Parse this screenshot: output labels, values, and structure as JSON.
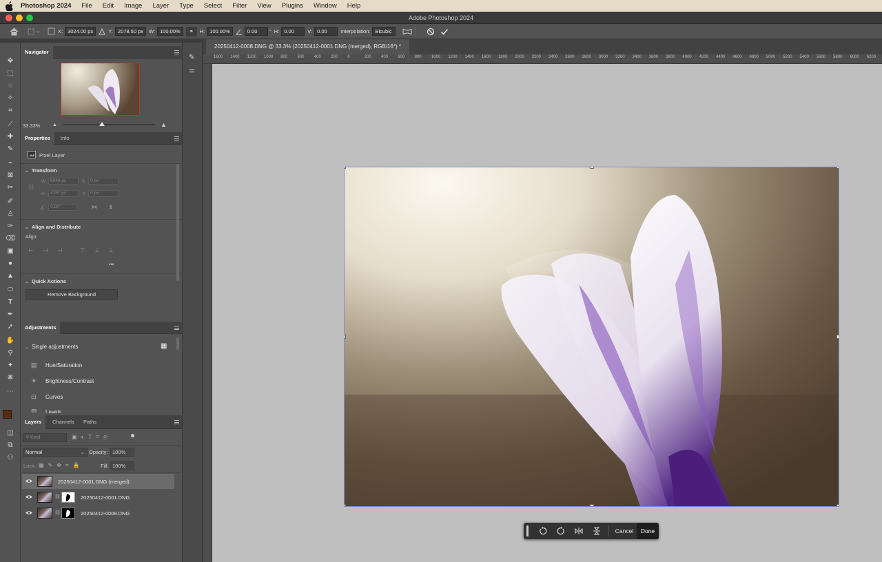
{
  "menubar": {
    "app": "Photoshop 2024",
    "items": [
      "File",
      "Edit",
      "Image",
      "Layer",
      "Type",
      "Select",
      "Filter",
      "View",
      "Plugins",
      "Window",
      "Help"
    ]
  },
  "window": {
    "title": "Adobe Photoshop 2024"
  },
  "options": {
    "x_label": "X:",
    "x_value": "3024.00 px",
    "y_label": "Y:",
    "y_value": "2078.50 px",
    "w_label": "W:",
    "w_value": "100.00%",
    "h_label": "H:",
    "h_value": "100.00%",
    "angle_value": "0.00",
    "angle_unit": "°",
    "hskew_label": "H:",
    "hskew_value": "0.00",
    "vskew_label": "V:",
    "vskew_value": "0.00",
    "interp_label": "Interpolation:",
    "interp_value": "Bicubic"
  },
  "document": {
    "tab_title": "20250412-0008.DNG @ 33.3% (20250412-0001.DNG (merged), RGB/16*) *"
  },
  "ruler": {
    "h_labels": [
      "1600",
      "1400",
      "1200",
      "1000",
      "800",
      "600",
      "400",
      "200",
      "0",
      "200",
      "400",
      "600",
      "800",
      "1000",
      "1200",
      "1400",
      "1600",
      "1800",
      "2000",
      "2200",
      "2400",
      "2600",
      "2800",
      "3000",
      "3200",
      "3400",
      "3600",
      "3800",
      "4000",
      "4200",
      "4400",
      "4600",
      "4800",
      "5000",
      "5200",
      "5400",
      "5600",
      "5800",
      "6000",
      "6200",
      "6400"
    ]
  },
  "navigator": {
    "tab": "Navigator",
    "zoom": "33.33%",
    "slider_fraction": 0.42
  },
  "properties": {
    "tabs": [
      "Properties",
      "Info"
    ],
    "layer_type": "Pixel Layer",
    "transform_title": "Transform",
    "w_label": "W:",
    "w_value": "6048 px",
    "x_label": "X:",
    "x_value": "0 px",
    "h_label": "H:",
    "h_value": "4157 px",
    "y_label": "Y:",
    "y_value": "0 px",
    "angle_value": "0.00°",
    "align_title": "Align and Distribute",
    "align_label": "Align:",
    "more": "•••",
    "quick_title": "Quick Actions",
    "remove_bg": "Remove Background"
  },
  "adjustments": {
    "tab": "Adjustments",
    "section": "Single adjustments",
    "items": [
      "Hue/Saturation",
      "Brightness/Contrast",
      "Curves",
      "Levels"
    ]
  },
  "layers": {
    "tabs": [
      "Layers",
      "Channels",
      "Paths"
    ],
    "kind_placeholder": "Kind",
    "blend_mode": "Normal",
    "opacity_label": "Opacity:",
    "opacity_value": "100%",
    "lock_label": "Lock:",
    "fill_label": "Fill:",
    "fill_value": "100%",
    "rows": [
      "20250412-0001.DNG (merged)",
      "20250412-0001.DNG",
      "20250412-0008.DNG"
    ]
  },
  "ctxbar": {
    "cancel": "Cancel",
    "done": "Done"
  },
  "colors": {
    "foreground": "#5a2a0e",
    "background": "#ffffff",
    "selection": "#7d8bd6"
  }
}
